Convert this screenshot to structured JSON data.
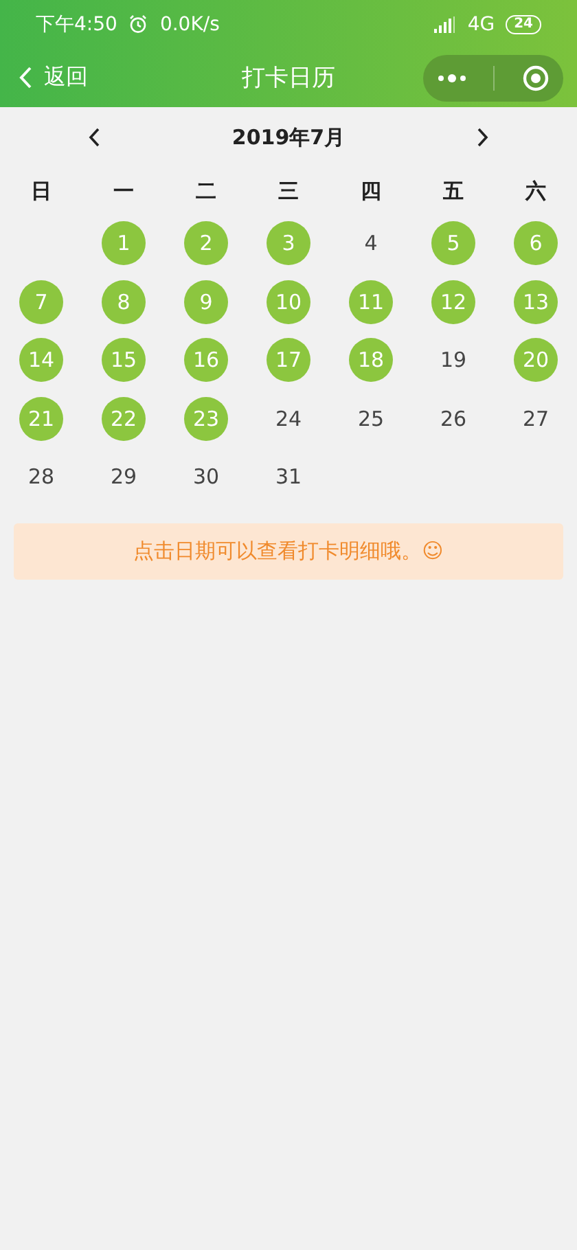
{
  "status_bar": {
    "time": "下午4:50",
    "speed": "0.0K/s",
    "network": "4G",
    "battery": "24"
  },
  "nav_bar": {
    "back_label": "返回",
    "title": "打卡日历"
  },
  "calendar": {
    "month": "2019年7月",
    "weekdays": [
      "日",
      "一",
      "二",
      "三",
      "四",
      "五",
      "六"
    ],
    "weeks": [
      [
        {
          "day": "1",
          "checked": true
        },
        {
          "day": "2",
          "checked": true
        },
        {
          "day": "3",
          "checked": true
        },
        {
          "day": "4",
          "checked": false
        },
        {
          "day": "5",
          "checked": true
        },
        {
          "day": "6",
          "checked": true
        }
      ],
      [
        {
          "day": "7",
          "checked": true
        },
        {
          "day": "8",
          "checked": true
        },
        {
          "day": "9",
          "checked": true
        },
        {
          "day": "10",
          "checked": true
        },
        {
          "day": "11",
          "checked": true
        },
        {
          "day": "12",
          "checked": true
        },
        {
          "day": "13",
          "checked": true
        }
      ],
      [
        {
          "day": "14",
          "checked": true
        },
        {
          "day": "15",
          "checked": true
        },
        {
          "day": "16",
          "checked": true
        },
        {
          "day": "17",
          "checked": true
        },
        {
          "day": "18",
          "checked": true
        },
        {
          "day": "19",
          "checked": false
        },
        {
          "day": "20",
          "checked": true
        }
      ],
      [
        {
          "day": "21",
          "checked": true
        },
        {
          "day": "22",
          "checked": true
        },
        {
          "day": "23",
          "checked": true
        },
        {
          "day": "24",
          "checked": false
        },
        {
          "day": "25",
          "checked": false
        },
        {
          "day": "26",
          "checked": false
        },
        {
          "day": "27",
          "checked": false
        }
      ],
      [
        {
          "day": "28",
          "checked": false
        },
        {
          "day": "29",
          "checked": false
        },
        {
          "day": "30",
          "checked": false
        },
        {
          "day": "31",
          "checked": false
        }
      ]
    ]
  },
  "notice": "点击日期可以查看打卡明细哦。☺"
}
